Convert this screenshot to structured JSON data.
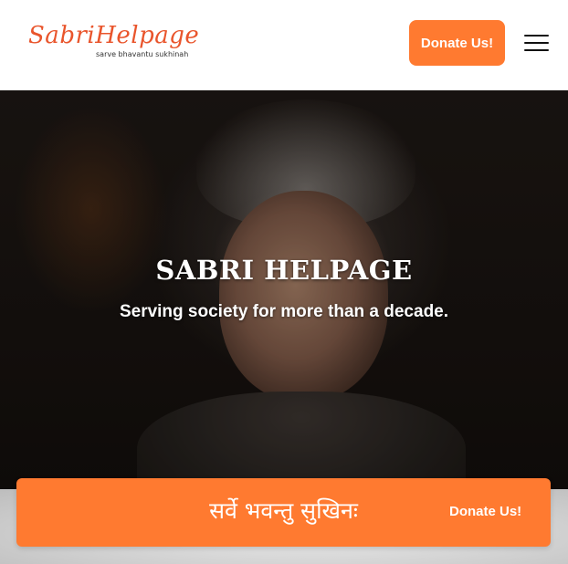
{
  "brand": {
    "logo_text": "SabriHelpage",
    "tagline": "sarve bhavantu sukhinah"
  },
  "header": {
    "donate_label": "Donate Us!"
  },
  "hero": {
    "title": "SABRI HELPAGE",
    "subtitle": "Serving society for more than a decade."
  },
  "banner": {
    "sanskrit": "सर्वे भवन्तु सुखिनः",
    "donate_label": "Donate Us!"
  },
  "colors": {
    "accent": "#ff7a30",
    "logo": "#e9552c"
  },
  "icons": {
    "menu": "hamburger-menu-icon"
  }
}
